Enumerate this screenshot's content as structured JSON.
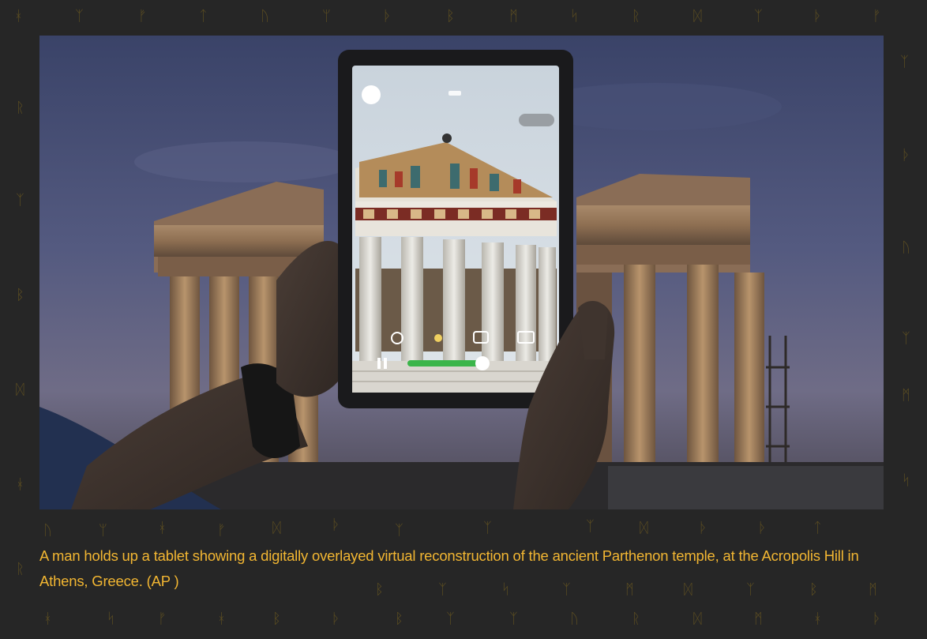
{
  "caption": {
    "text": "A man holds up a tablet showing a digitally overlayed virtual reconstruction of the ancient Parthenon temple, at the Acropolis Hill in Athens, Greece. (AP )",
    "color": "#f2b632"
  },
  "page": {
    "background": "#262626",
    "glyph_color": "#5a4c22"
  },
  "tablet_screen": {
    "zoom_label": "1.1"
  },
  "decor_glyphs": [
    "ᚼ",
    "ᛉ",
    "ᚠ",
    "ᛏ",
    "ᚢ",
    "ᛘ",
    "ᚦ",
    "ᛒ",
    "ᛗ",
    "ᛋ",
    "ᚱ",
    "ᛞ"
  ]
}
